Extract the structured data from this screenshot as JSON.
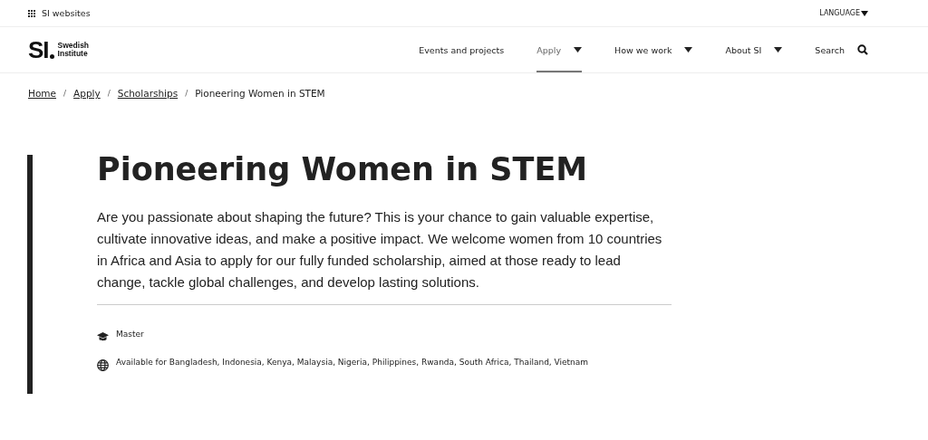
{
  "top_bar": {
    "sites_label": "SI websites",
    "language_label": "LANGUAGE"
  },
  "logo": {
    "mark": "SI",
    "name_line_1": "Swedish",
    "name_line_2": "Institute"
  },
  "nav": [
    {
      "label": "Events and projects",
      "kind": "link",
      "selected": false
    },
    {
      "label": "Apply",
      "kind": "menu",
      "selected": true
    },
    {
      "label": "How we work",
      "kind": "menu",
      "selected": false
    },
    {
      "label": "About SI",
      "kind": "menu",
      "selected": false
    },
    {
      "label": "Search",
      "kind": "search",
      "selected": false
    }
  ],
  "breadcrumb": {
    "separator": "/",
    "items": [
      {
        "label": "Home",
        "kind": "link"
      },
      {
        "label": "Apply",
        "kind": "link"
      },
      {
        "label": "Scholarships",
        "kind": "link"
      },
      {
        "label": "Pioneering Women in STEM",
        "kind": "current"
      }
    ]
  },
  "title": "Pioneering Women in STEM",
  "intro": "Are you passionate about shaping the future? This is your chance to gain valuable expertise, cultivate innovative ideas, and make a positive impact. We welcome women from 10 countries in Africa and Asia to apply for our fully funded scholarship, aimed at those ready to lead change, tackle global challenges, and develop lasting solutions.",
  "facts": [
    {
      "kind": "level",
      "text": "Master"
    },
    {
      "kind": "countries",
      "text": "Available for Bangladesh, Indonesia, Kenya, Malaysia, Nigeria, Philippines, Rwanda, South Africa, Thailand, Vietnam"
    }
  ]
}
